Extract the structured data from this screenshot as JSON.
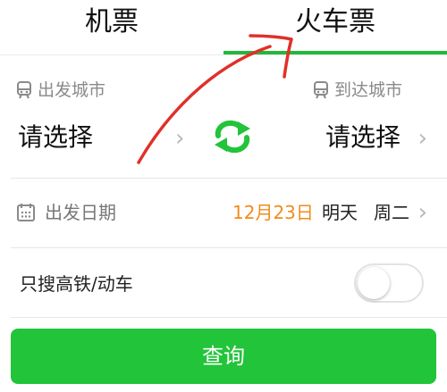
{
  "tabs": [
    {
      "label": "机票"
    },
    {
      "label": "火车票"
    }
  ],
  "cities": {
    "from_label": "出发城市",
    "from_value": "请选择",
    "to_label": "到达城市",
    "to_value": "请选择"
  },
  "date": {
    "label": "出发日期",
    "value": "12月23日",
    "relative": "明天",
    "weekday": "周二"
  },
  "filter": {
    "label": "只搜高铁/动车",
    "enabled": false
  },
  "search_button": "查询",
  "colors": {
    "accent": "#22c43a",
    "tab_underline": "#22b83a",
    "date": "#f08c1a",
    "annotation": "#e0302a"
  },
  "icons": [
    "train-icon",
    "swap-icon",
    "calendar-icon",
    "chevron-right-icon"
  ]
}
